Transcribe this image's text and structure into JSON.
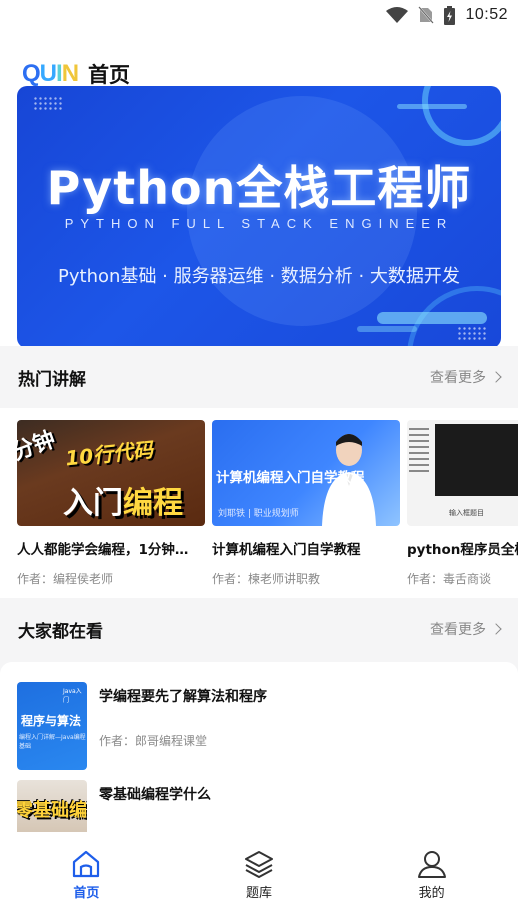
{
  "status_bar": {
    "time": "10:52"
  },
  "header": {
    "logo_letters": [
      "Q",
      "U",
      "I",
      "N"
    ],
    "title": "首页"
  },
  "banner": {
    "title": "Python全栈工程师",
    "subtitle": "PYTHON FULL STACK ENGINEER",
    "tags": "Python基础 · 服务器运维 · 数据分析 · 大数据开发"
  },
  "hot_section": {
    "title": "热门讲解",
    "more": "查看更多",
    "cards": [
      {
        "title": "人人都能学会编程，1分钟…",
        "author": "作者：编程侯老师",
        "thumb_text": [
          "分钟",
          "10行代码",
          "入门",
          "编程"
        ]
      },
      {
        "title": "计算机编程入门自学教程",
        "author": "作者：楝老师讲职教",
        "thumb_text": [
          "计算机编程入门自学教程",
          "刘耶铁 | 职业规划师"
        ]
      },
      {
        "title": "python程序员全栈",
        "author": "作者：毒舌商谈",
        "thumb_text": [
          "输入框题目"
        ]
      }
    ]
  },
  "popular_section": {
    "title": "大家都在看",
    "more": "查看更多",
    "items": [
      {
        "title": "学编程要先了解算法和程序",
        "author": "作者：郎哥编程课堂",
        "thumb_text": [
          "程序与算法",
          "编程入门详解—Java编程基础",
          "Java入门"
        ]
      },
      {
        "title": "零基础编程学什么",
        "author": "",
        "thumb_text": [
          "零基础编程"
        ]
      }
    ]
  },
  "tabbar": {
    "tabs": [
      {
        "label": "首页",
        "icon": "home-icon",
        "active": true
      },
      {
        "label": "题库",
        "icon": "layers-icon",
        "active": false
      },
      {
        "label": "我的",
        "icon": "user-icon",
        "active": false
      }
    ]
  },
  "colors": {
    "accent": "#1e5eea",
    "banner_bg": "#1d56e8",
    "band_bg": "#f5f5f6"
  }
}
